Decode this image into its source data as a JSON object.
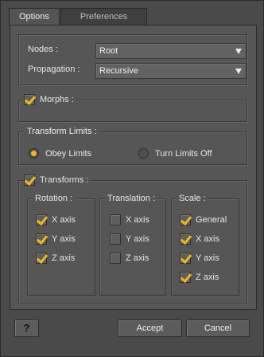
{
  "tabs": [
    {
      "label": "Options"
    },
    {
      "label": "Preferences"
    }
  ],
  "nodes": {
    "label": "Nodes :",
    "value": "Root"
  },
  "propagation": {
    "label": "Propagation :",
    "value": "Recursive"
  },
  "morphs": {
    "label": "Morphs :",
    "checked": true
  },
  "transform_limits": {
    "title": "Transform Limits :",
    "obey": "Obey Limits",
    "off": "Turn Limits Off",
    "selected": "obey"
  },
  "transforms": {
    "label": "Transforms :",
    "checked": true,
    "rotation": {
      "title": "Rotation :",
      "x": "X axis",
      "y": "Y axis",
      "z": "Z axis"
    },
    "translation": {
      "title": "Translation :",
      "x": "X axis",
      "y": "Y axis",
      "z": "Z axis"
    },
    "scale": {
      "title": "Scale :",
      "general": "General",
      "x": "X axis",
      "y": "Y axis",
      "z": "Z axis"
    }
  },
  "buttons": {
    "help": "?",
    "accept": "Accept",
    "cancel": "Cancel"
  },
  "colors": {
    "accent": "#f2b51c",
    "panel": "#565656",
    "window": "#4a4a4a"
  }
}
